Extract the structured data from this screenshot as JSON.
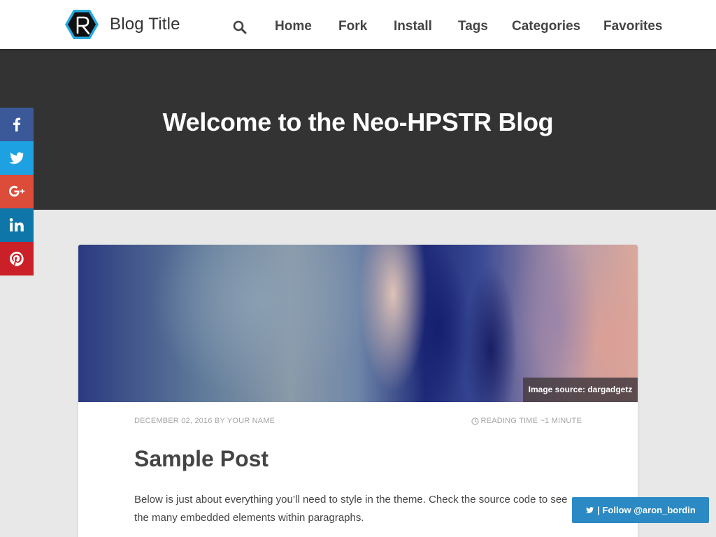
{
  "header": {
    "site_title": "Blog Title",
    "nav": [
      {
        "label": "Home"
      },
      {
        "label": "Fork"
      },
      {
        "label": "Install"
      },
      {
        "label": "Tags"
      },
      {
        "label": "Categories"
      },
      {
        "label": "Favorites"
      }
    ]
  },
  "hero": {
    "title": "Welcome to the Neo-HPSTR Blog"
  },
  "share": [
    {
      "network": "facebook",
      "icon": "facebook-icon",
      "color": "#3b5998"
    },
    {
      "network": "twitter",
      "icon": "twitter-icon",
      "color": "#1da1e2"
    },
    {
      "network": "google-plus",
      "icon": "google-plus-icon",
      "color": "#dd4b39"
    },
    {
      "network": "linkedin",
      "icon": "linkedin-icon",
      "color": "#0e76a8"
    },
    {
      "network": "pinterest",
      "icon": "pinterest-icon",
      "color": "#cb2027"
    }
  ],
  "post": {
    "image_credit": "Image source: dargadgetz",
    "meta_left": "December 02, 2016 by Your Name",
    "reading_time": "Reading time ~1 minute",
    "title": "Sample Post",
    "excerpt": "Below is just about everything you’ll need to style in the theme. Check the source code to see the many embedded elements within paragraphs."
  },
  "follow": {
    "label": "| Follow @aron_bordin"
  },
  "colors": {
    "hero_bg": "#333333",
    "page_bg": "#e8e8e8",
    "follow_bg": "#2b8ac3"
  }
}
